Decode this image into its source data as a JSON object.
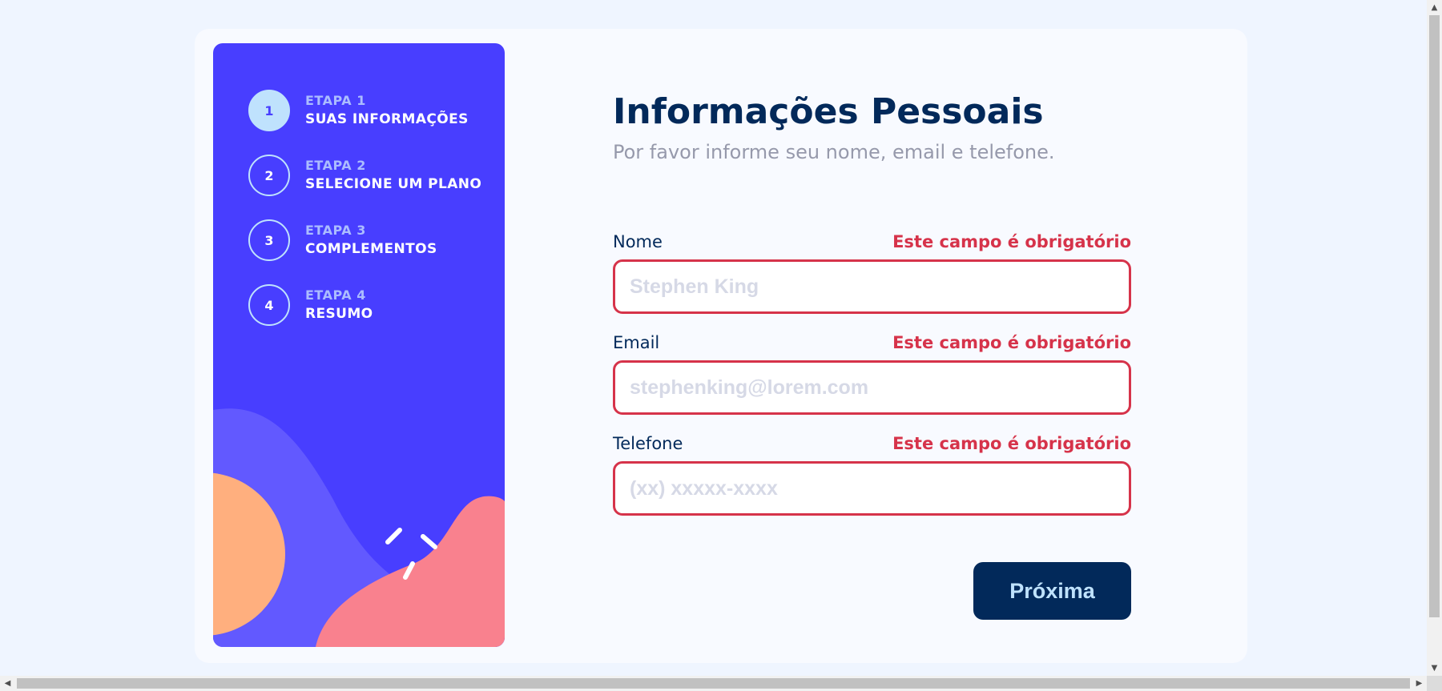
{
  "sidebar": {
    "steps": [
      {
        "number": "1",
        "label": "ETAPA 1",
        "title": "SUAS INFORMAÇÕES",
        "active": true
      },
      {
        "number": "2",
        "label": "ETAPA 2",
        "title": "SELECIONE UM PLANO",
        "active": false
      },
      {
        "number": "3",
        "label": "ETAPA 3",
        "title": "COMPLEMENTOS",
        "active": false
      },
      {
        "number": "4",
        "label": "ETAPA 4",
        "title": "RESUMO",
        "active": false
      }
    ]
  },
  "form": {
    "title": "Informações Pessoais",
    "subtitle": "Por favor informe seu nome, email e telefone.",
    "fields": [
      {
        "label": "Nome",
        "error": "Este campo é obrigatório",
        "value": "",
        "placeholder": "Stephen King"
      },
      {
        "label": "Email",
        "error": "Este campo é obrigatório",
        "value": "",
        "placeholder": "stephenking@lorem.com"
      },
      {
        "label": "Telefone",
        "error": "Este campo é obrigatório",
        "value": "",
        "placeholder": "(xx) xxxxx-xxxx"
      }
    ],
    "next_label": "Próxima"
  },
  "colors": {
    "sidebar_bg": "#483eff",
    "active_step": "#bfe2fd",
    "title": "#02295a",
    "error": "#d6334a",
    "button_bg": "#02295a",
    "button_text": "#bfe2fd",
    "deco_lilac": "#6259ff",
    "deco_orange": "#ffaf7e",
    "deco_pink": "#f9818e"
  },
  "icons": {
    "scroll_up": "▲",
    "scroll_down": "▼",
    "scroll_left": "◀",
    "scroll_right": "▶"
  }
}
